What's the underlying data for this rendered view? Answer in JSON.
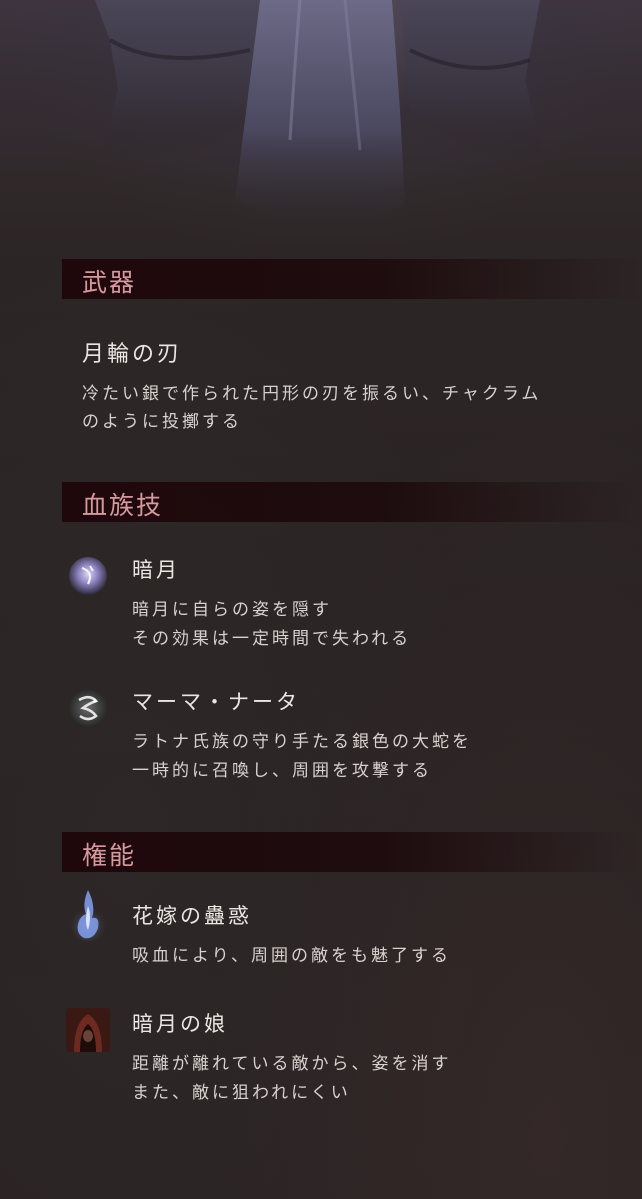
{
  "sections": {
    "weapon": {
      "title": "武器",
      "name": "月輪の刃",
      "desc_line1": "冷たい銀で作られた円形の刃を振るい、チャクラム",
      "desc_line2": "のように投擲する"
    },
    "bloodline": {
      "title": "血族技",
      "skills": [
        {
          "name": "暗月",
          "icon": "dark-moon-orb-icon",
          "line1": "暗月に自らの姿を隠す",
          "line2": "その効果は一定時間で失われる"
        },
        {
          "name": "マーマ・ナータ",
          "icon": "silver-serpent-icon",
          "line1": "ラトナ氏族の守り手たる銀色の大蛇を",
          "line2": "一時的に召喚し、周囲を攻撃する"
        }
      ]
    },
    "powers": {
      "title": "権能",
      "skills": [
        {
          "name": "花嫁の蠱惑",
          "icon": "blue-flame-icon",
          "line1": "吸血により、周囲の敵をも魅了する"
        },
        {
          "name": "暗月の娘",
          "icon": "hooded-figure-icon",
          "line1": "距離が離れている敵から、姿を消す",
          "line2": "また、敵に狙われにくい"
        }
      ]
    }
  },
  "colors": {
    "background": "#2b2424",
    "header_band": "#1e060a",
    "header_text": "#d69a9e",
    "body_text": "#e8e2de"
  }
}
